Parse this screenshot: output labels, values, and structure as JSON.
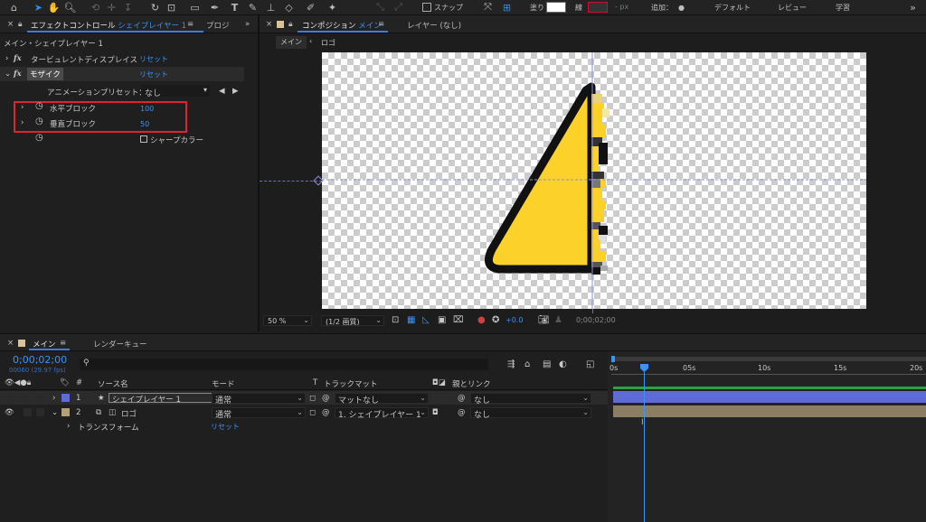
{
  "toolbar": {
    "snap_label": "スナップ",
    "fill_label": "塗り",
    "stroke_label": "線",
    "px_label": "- px",
    "add_label": "追加：",
    "default_label": "デフォルト",
    "review_label": "レビュー",
    "learn_label": "学習",
    "fill_color": "#ffffff",
    "stroke_color": "#c8102e"
  },
  "effect_panel": {
    "tab_label": "エフェクトコントロール シェイプレイヤー 1",
    "tab_prefix": "エフェクトコントロール",
    "tab_layer": "シェイプレイヤー 1",
    "menu_glyph": "≡",
    "project_tab": "プロジ",
    "breadcrumb": "メイン・シェイプレイヤー 1",
    "effects": [
      {
        "name": "タービュレントディスプレイス",
        "reset": "リセット"
      },
      {
        "name": "モザイク",
        "reset": "リセット"
      }
    ],
    "preset_label": "アニメーションプリセット：",
    "preset_value": "なし",
    "h_block_label": "水平ブロック",
    "h_block_value": "100",
    "v_block_label": "垂直ブロック",
    "v_block_value": "50",
    "sharp_color_label": "シャープカラー"
  },
  "comp_panel": {
    "tab_label": "コンポジション メイン",
    "tab_prefix": "コンポジション",
    "tab_name": "メイン",
    "layer_tab": "レイヤー (なし)",
    "breadcrumb_main": "メイン",
    "breadcrumb_logo": "ロゴ",
    "zoom": "50 %",
    "resolution": "(1/2 画質)",
    "exposure": "+0.0",
    "timecode": "0;00;02;00"
  },
  "timeline": {
    "tab_main": "メイン",
    "tab_render": "レンダーキュー",
    "timecode": "0;00;02;00",
    "frame_info": "00060 (29.97 fps)",
    "search_placeholder": "",
    "col_source": "ソース名",
    "col_mode": "モード",
    "col_t": "T",
    "col_trackmatte": "トラックマット",
    "col_parent": "親とリンク",
    "ruler": [
      "0s",
      "05s",
      "10s",
      "15s",
      "20s"
    ],
    "layers": [
      {
        "num": "1",
        "name": "シェイプレイヤー 1",
        "mode": "通常",
        "matte": "マットなし",
        "parent": "なし",
        "color": "#5e6bd4"
      },
      {
        "num": "2",
        "name": "ロゴ",
        "mode": "通常",
        "matte": "1. シェイプレイヤー 1",
        "parent": "なし",
        "color": "#b2a07a"
      }
    ],
    "transform_label": "トランスフォーム",
    "transform_reset": "リセット"
  },
  "colors": {
    "accent": "#3b93f5",
    "highlight_box": "#e0242b",
    "logo_yellow": "#fcd12a"
  }
}
